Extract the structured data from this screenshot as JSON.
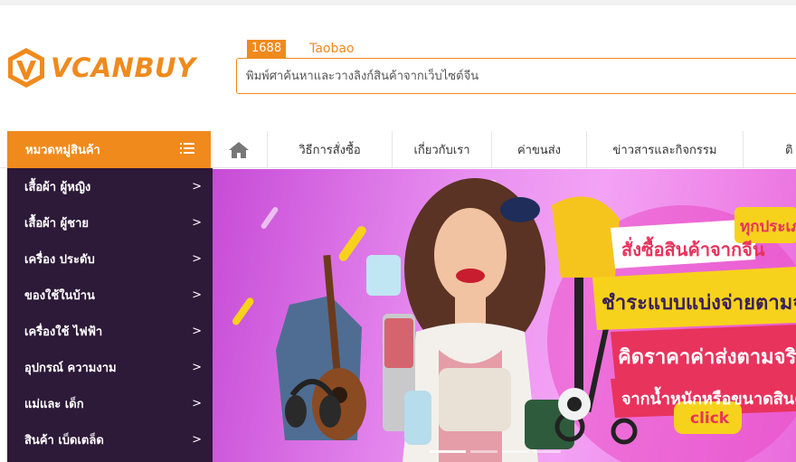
{
  "brand": {
    "name": "VCANBUY",
    "color": "#f08a1d"
  },
  "search": {
    "tabs": [
      {
        "label": "1688",
        "active": true
      },
      {
        "label": "Taobao",
        "active": false
      }
    ],
    "placeholder": "พิมพ์ศาค้นหาและวางลิงก์สินค้าจากเว็บไซต์จีน"
  },
  "nav": {
    "category_header": "หมวดหมู่สินค้า",
    "home_icon": "home-icon",
    "items": [
      "วิธีการสั่งซื้อ",
      "เกี่ยวกับเรา",
      "ค่าขนส่ง",
      "ข่าวสารและกิจกรรม",
      "ติ"
    ]
  },
  "sidebar": {
    "items": [
      {
        "label": "เสื้อผ้า ผู้หญิง"
      },
      {
        "label": "เสื้อผ้า ผู้ชาย"
      },
      {
        "label": "เครื่อง ประดับ"
      },
      {
        "label": "ของใช้ในบ้าน"
      },
      {
        "label": "เครื่องใช้ ไฟฟ้า"
      },
      {
        "label": "อุปกรณ์ ความงาม"
      },
      {
        "label": "แม่และ เด็ก"
      },
      {
        "label": "สินค้า เบ็ดเตล็ด"
      }
    ],
    "arrow": ">"
  },
  "banner": {
    "line1": "สั่งซื้อสินค้าจากจีน",
    "line1_tag": "ทุกประเภท",
    "line2": "ชำระแบบแบ่งจ่ายตามจริง",
    "line3": "คิดราคาค่าส่งตามจริง",
    "line4": "จากน้ำหนักหรือขนาดสินค้า",
    "cta": "click"
  },
  "colors": {
    "accent": "#f08a1d",
    "sidebar_bg": "#2d1938",
    "banner_yellow": "#f7d21c",
    "banner_red": "#e8335d"
  }
}
